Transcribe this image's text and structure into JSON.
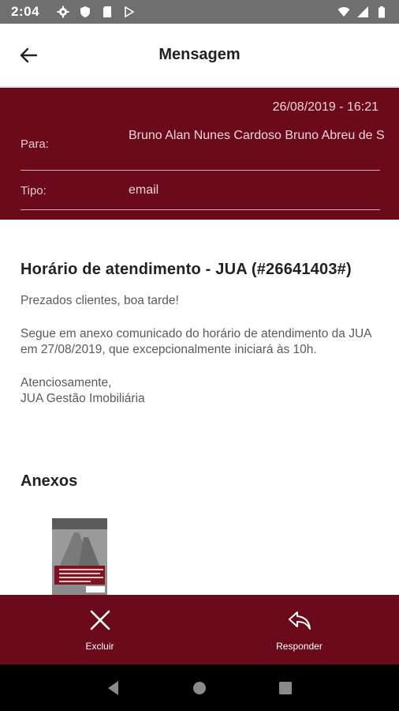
{
  "status_bar": {
    "time": "2:04",
    "icons_left": [
      "settings-icon",
      "shield-icon",
      "sd-card-icon",
      "play-store-icon"
    ],
    "icons_right": [
      "wifi-icon",
      "cell-signal-icon",
      "battery-icon"
    ]
  },
  "app_bar": {
    "title": "Mensagem",
    "back_icon": "arrow-back-icon"
  },
  "message_header": {
    "date": "26/08/2019 - 16:21",
    "to_label": "Para:",
    "to_value": "Bruno Alan Nunes Cardoso  Bruno Abreu de S",
    "type_label": "Tipo:",
    "type_value": "email"
  },
  "message": {
    "subject": "Horário de atendimento - JUA (#26641403#)",
    "greeting": "Prezados clientes, boa tarde!",
    "body": "Segue em anexo comunicado do horário de atendimento da JUA em 27/08/2019, que excepcionalmente iniciará às 10h.",
    "signoff_1": "Atenciosamente,",
    "signoff_2": "JUA Gestão Imobiliária"
  },
  "attachments": {
    "title": "Anexos"
  },
  "actions": {
    "delete_label": "Excluir",
    "reply_label": "Responder"
  },
  "colors": {
    "primary": "#6b0a1a",
    "status_bar": "#6f6f6f"
  }
}
